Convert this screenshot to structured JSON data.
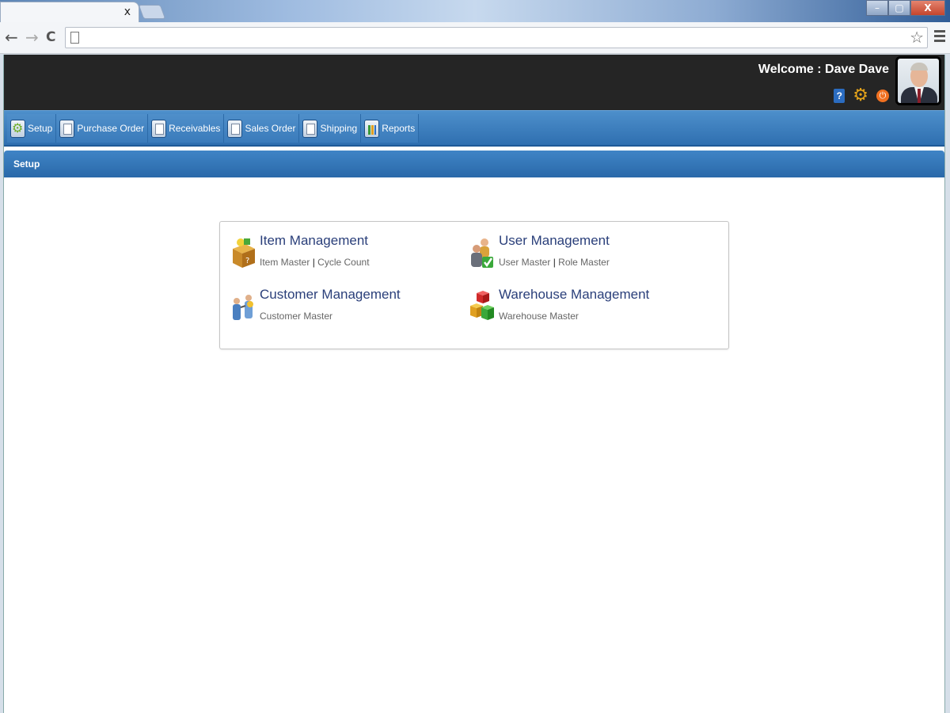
{
  "browser": {
    "window_buttons": [
      "–",
      "▢",
      "X"
    ],
    "tab_close": "x",
    "nav": {
      "back": "←",
      "forward": "→",
      "reload": "C"
    },
    "star": "☆"
  },
  "header": {
    "welcome": "Welcome : Dave Dave",
    "help_label": "?",
    "gear_glyph": "⚙",
    "power_glyph": "⏻"
  },
  "menu": {
    "items": [
      {
        "label": "Setup",
        "icon": "cog-icon"
      },
      {
        "label": "Purchase Order",
        "icon": "document-icon"
      },
      {
        "label": "Receivables",
        "icon": "document-icon"
      },
      {
        "label": "Sales Order",
        "icon": "document-icon"
      },
      {
        "label": "Shipping",
        "icon": "document-icon"
      },
      {
        "label": "Reports",
        "icon": "chart-icon"
      }
    ]
  },
  "section": {
    "title": "Setup"
  },
  "modules": {
    "item": {
      "title": "Item Management",
      "links": [
        "Item Master",
        "Cycle Count"
      ],
      "sep": "|"
    },
    "user": {
      "title": "User Management",
      "links": [
        "User Master",
        "Role Master"
      ],
      "sep": "|"
    },
    "customer": {
      "title": "Customer Management",
      "links": [
        "Customer Master"
      ]
    },
    "warehouse": {
      "title": "Warehouse Management",
      "links": [
        "Warehouse Master"
      ]
    }
  },
  "colors": {
    "menu_blue": "#3a7bbb",
    "header_bg": "#252525",
    "title_blue": "#2a3f7a"
  }
}
